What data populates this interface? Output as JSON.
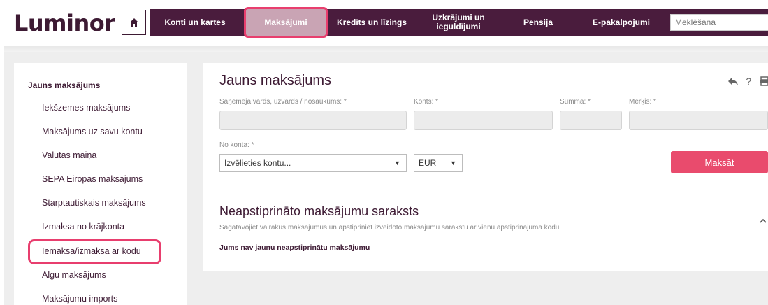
{
  "logo": "Luminor",
  "nav": {
    "items": [
      {
        "label": "Konti un kartes"
      },
      {
        "label": "Maksājumi"
      },
      {
        "label": "Kredīts un līzings"
      },
      {
        "label": "Uzkrājumi un\nieguldījumi"
      },
      {
        "label": "Pensija"
      },
      {
        "label": "E-pakalpojumi"
      }
    ],
    "search_placeholder": "Meklēšana"
  },
  "sidebar": {
    "title": "Jauns maksājums",
    "items": [
      {
        "label": "Iekšzemes maksājums"
      },
      {
        "label": "Maksājums uz savu kontu"
      },
      {
        "label": "Valūtas maiņa"
      },
      {
        "label": "SEPA Eiropas maksājums"
      },
      {
        "label": "Starptautiskais maksājums"
      },
      {
        "label": "Izmaksa no krājkonta"
      },
      {
        "label": "Iemaksa/izmaksa ar kodu"
      },
      {
        "label": "Algu maksājums"
      },
      {
        "label": "Maksājumu imports"
      }
    ]
  },
  "form": {
    "title": "Jauns maksājums",
    "recipient_label": "Saņēmēja vārds, uzvārds / nosaukums: *",
    "account_label": "Konts: *",
    "amount_label": "Summa: *",
    "purpose_label": "Mērķis: *",
    "from_account_label": "No konta: *",
    "from_account_value": "Izvēlieties kontu...",
    "currency_value": "EUR",
    "pay_button": "Maksāt"
  },
  "unconfirmed": {
    "title": "Neapstiprināto maksājumu saraksts",
    "subtitle": "Sagatavojiet vairākus maksājumus un apstipriniet izveidoto maksājumu sarakstu ar vienu apstiprinājuma kodu",
    "empty_text": "Jums nav jaunu neapstiprinātu maksājumu"
  },
  "colors": {
    "brand": "#4a1c3d",
    "accent": "#e94b6d"
  },
  "icons": [
    "home-icon",
    "search-icon",
    "back-arrow-icon",
    "help-icon",
    "print-icon",
    "chevron-up-icon",
    "dropdown-arrow-icon"
  ]
}
